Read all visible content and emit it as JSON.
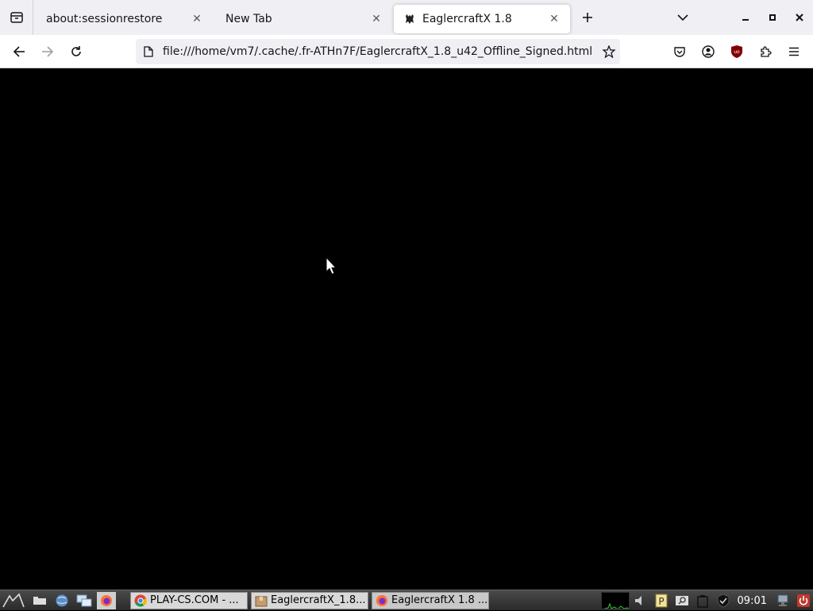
{
  "browser": {
    "tabs": [
      {
        "label": "about:sessionrestore",
        "active": false
      },
      {
        "label": "New Tab",
        "active": false
      },
      {
        "label": "EaglercraftX 1.8",
        "active": true
      }
    ],
    "url": "file:///home/vm7/.cache/.fr-ATHn7F/EaglercraftX_1.8_u42_Offline_Signed.html"
  },
  "taskbar": {
    "tasks": [
      {
        "label": "PLAY-CS.COM - ...",
        "icon": "chrome-icon"
      },
      {
        "label": "EaglercraftX_1.8...",
        "icon": "package-icon"
      },
      {
        "label": "EaglercraftX 1.8 ...",
        "icon": "firefox-icon"
      }
    ],
    "clock": "09:01"
  },
  "colors": {
    "tabstrip_bg": "#f0f0f4",
    "content_bg": "#000000",
    "ublock_red": "#800000"
  }
}
